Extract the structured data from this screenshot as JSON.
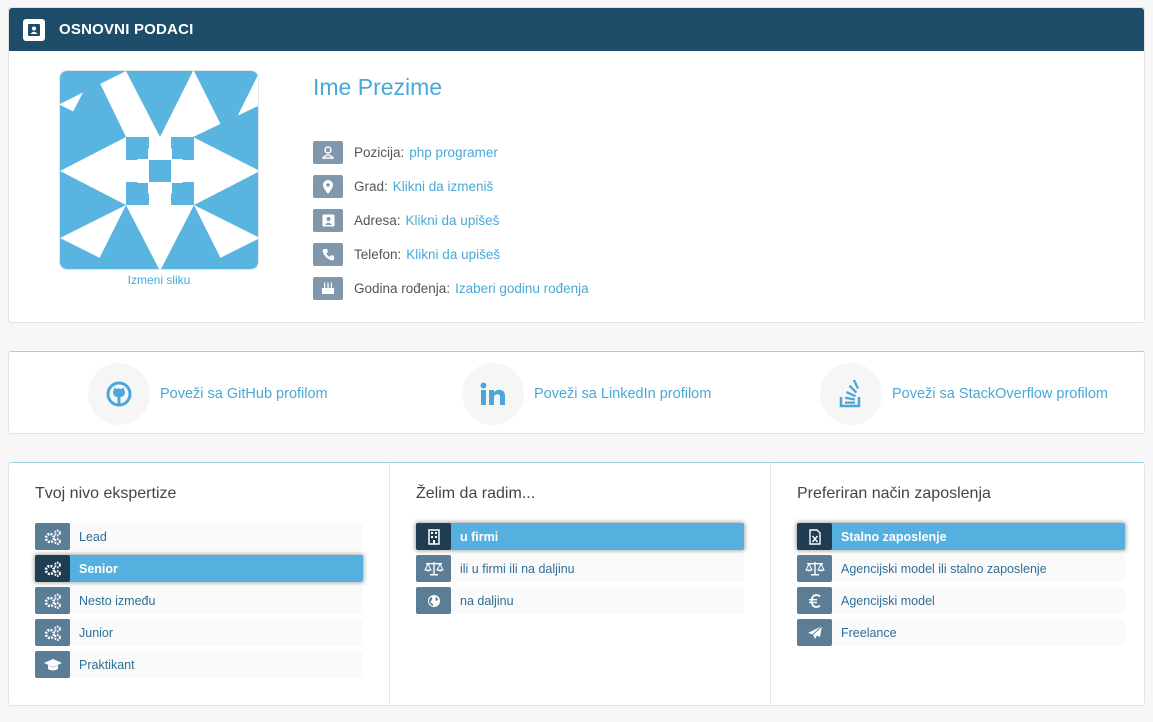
{
  "basic": {
    "title": "OSNOVNI PODACI",
    "name": "Ime Prezime",
    "change_photo": "Izmeni sliku",
    "rows": [
      {
        "label": "Pozicija:",
        "value": "php programer",
        "icon": "user-icon"
      },
      {
        "label": "Grad:",
        "value": "Klikni da izmeniš",
        "icon": "map-marker-icon"
      },
      {
        "label": "Adresa:",
        "value": "Klikni da upišeš",
        "icon": "address-card-icon"
      },
      {
        "label": "Telefon:",
        "value": "Klikni da upišeš",
        "icon": "phone-icon"
      },
      {
        "label": "Godina rođenja:",
        "value": "Izaberi godinu rođenja",
        "icon": "birthday-cake-icon"
      }
    ]
  },
  "social": {
    "github": "Poveži sa GitHub profilom",
    "linkedin": "Poveži sa LinkedIn profilom",
    "stackoverflow": "Poveži sa StackOverflow profilom"
  },
  "prefs": {
    "expertise": {
      "title": "Tvoj nivo ekspertize",
      "options": [
        {
          "label": "Lead",
          "icon": "gears-icon",
          "active": false
        },
        {
          "label": "Senior",
          "icon": "gears-icon",
          "active": true
        },
        {
          "label": "Nesto između",
          "icon": "gears-icon",
          "active": false
        },
        {
          "label": "Junior",
          "icon": "gears-icon",
          "active": false
        },
        {
          "label": "Praktikant",
          "icon": "graduation-cap-icon",
          "active": false
        }
      ]
    },
    "work": {
      "title": "Želim da radim...",
      "options": [
        {
          "label": "u firmi",
          "icon": "building-icon",
          "active": true
        },
        {
          "label": "ili u firmi ili na daljinu",
          "icon": "balance-scale-icon",
          "active": false
        },
        {
          "label": "na daljinu",
          "icon": "globe-icon",
          "active": false
        }
      ]
    },
    "employment": {
      "title": "Preferiran način zaposlenja",
      "options": [
        {
          "label": "Stalno zaposlenje",
          "icon": "file-excel-icon",
          "active": true
        },
        {
          "label": "Agencijski model ili stalno zaposlenje",
          "icon": "balance-scale-icon",
          "active": false
        },
        {
          "label": "Agencijski model",
          "icon": "euro-icon",
          "active": false
        },
        {
          "label": "Freelance",
          "icon": "paper-plane-icon",
          "active": false
        }
      ]
    }
  },
  "colors": {
    "header": "#1e4d6a",
    "accent": "#4aa8d8",
    "active_option": "#55b0df"
  }
}
